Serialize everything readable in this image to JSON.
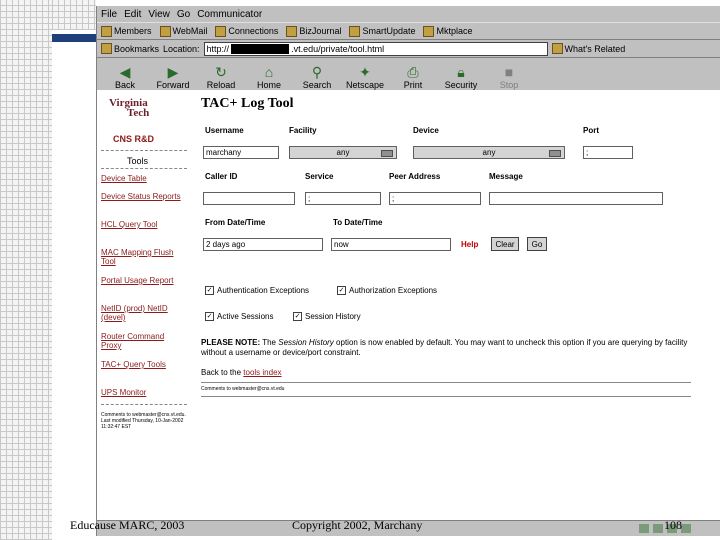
{
  "slide": {
    "footer_left": "Educause MARC, 2003",
    "footer_center": "Copyright 2002, Marchany",
    "page_number": "108"
  },
  "browser": {
    "menu": [
      "File",
      "Edit",
      "View",
      "Go",
      "Communicator"
    ],
    "personal_toolbar": [
      "Members",
      "WebMail",
      "Connections",
      "BizJournal",
      "SmartUpdate",
      "Mktplace"
    ],
    "bookmarks_label": "Bookmarks",
    "location_label": "Location:",
    "url_prefix": "http://",
    "url_suffix": ".vt.edu/private/tool.html",
    "whats_related": "What's Related",
    "toolbar": [
      "Back",
      "Forward",
      "Reload",
      "Home",
      "Search",
      "Netscape",
      "Print",
      "Security",
      "Stop"
    ]
  },
  "sidebar": {
    "logo_line1": "Virginia",
    "logo_line2": "Tech",
    "org": "CNS R&D",
    "tools_heading": "Tools",
    "links": [
      "Device Table",
      "Device Status Reports",
      "HCL Query Tool",
      "MAC Mapping Flush Tool",
      "Portal Usage Report",
      "NetID (prod) NetID (devel)",
      "Router Command Proxy",
      "TAC+ Query Tools",
      "UPS Monitor"
    ],
    "fine_print": "Comments to webmaster@cns.vt.edu. Last modified Thursday, 10-Jan-2002 11:32:47 EST"
  },
  "form": {
    "title": "TAC+ Log Tool",
    "labels": {
      "username": "Username",
      "facility": "Facility",
      "device": "Device",
      "port": "Port",
      "caller_id": "Caller ID",
      "service": "Service",
      "peer_address": "Peer Address",
      "message": "Message",
      "from": "From Date/Time",
      "to": "To Date/Time"
    },
    "values": {
      "username": "marchany",
      "facility": "any",
      "device": "any",
      "port": ";",
      "service": ";",
      "peer_address": ";",
      "from": "2 days ago",
      "to": "now"
    },
    "help": "Help",
    "clear": "Clear",
    "go": "Go",
    "checkboxes": [
      "Authentication Exceptions",
      "Authorization Exceptions",
      "Active Sessions",
      "Session History"
    ],
    "note_strong": "PLEASE NOTE:",
    "note_pre": "The",
    "note_em": "Session History",
    "note_post": "option is now enabled by default. You may want to uncheck this option if you are querying by facility without a username or device/port constraint.",
    "back_pre": "Back to the",
    "back_link": "tools index",
    "footer_mini": "Comments to webmaster@cns.vt.edu"
  }
}
